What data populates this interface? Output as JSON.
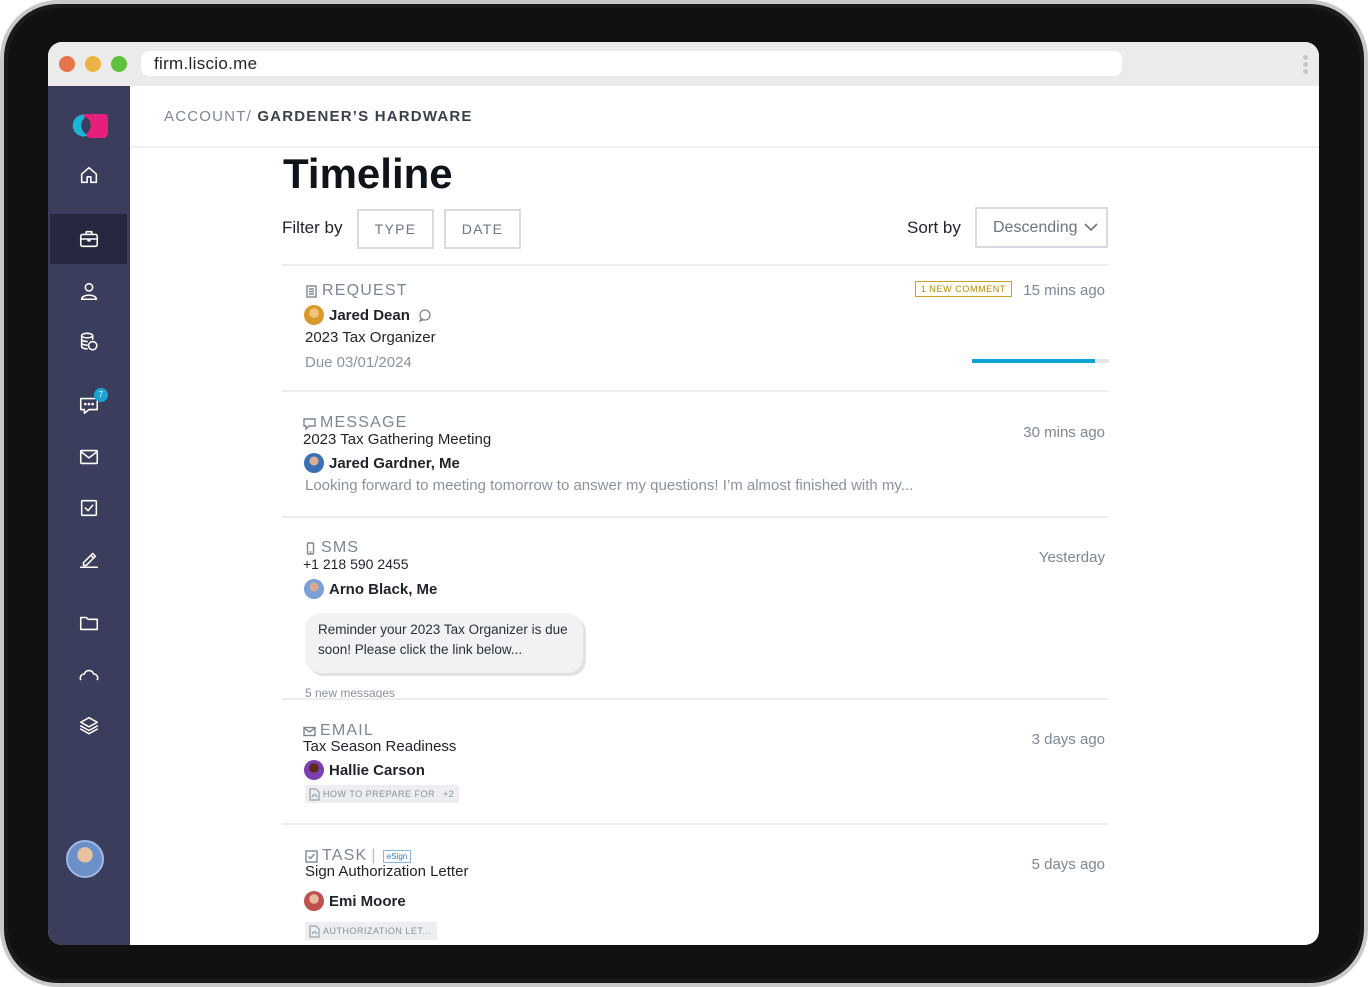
{
  "browser": {
    "url": "firm.liscio.me"
  },
  "sidebar": {
    "messages_badge": "7"
  },
  "breadcrumb": {
    "parent": "ACCOUNT/",
    "current": "GARDENER’S HARDWARE"
  },
  "page": {
    "title": "Timeline"
  },
  "filters": {
    "label": "Filter by",
    "type_label": "TYPE",
    "date_label": "DATE"
  },
  "sort": {
    "label": "Sort by",
    "value": "Descending"
  },
  "items": [
    {
      "kind": "REQUEST",
      "person": "Jared Dean",
      "title": "2023 Tax Organizer",
      "due": "Due 03/01/2024",
      "badge": "1 NEW COMMENT",
      "time": "15 mins ago",
      "progress": 0.9
    },
    {
      "kind": "MESSAGE",
      "title": "2023 Tax Gathering Meeting",
      "person": "Jared Gardner, Me",
      "preview": "Looking forward to meeting tomorrow to answer my questions! I’m almost finished with my...",
      "time": "30 mins ago"
    },
    {
      "kind": "SMS",
      "phone": "+1 218 590 2455",
      "person": "Arno Black, Me",
      "bubble": "Reminder your 2023 Tax Organizer is due soon! Please click the link below...",
      "new_messages": "5 new messages",
      "time": "Yesterday"
    },
    {
      "kind": "EMAIL",
      "title": "Tax Season Readiness",
      "person": "Hallie Carson",
      "attachment": "HOW TO PREPARE FOR",
      "more": "+2",
      "time": "3 days ago"
    },
    {
      "kind": "TASK",
      "tag": "eSign",
      "title": "Sign Authorization Letter",
      "person": "Emi Moore",
      "attachment": "AUTHORIZATION LET...",
      "time": "5 days ago"
    }
  ]
}
